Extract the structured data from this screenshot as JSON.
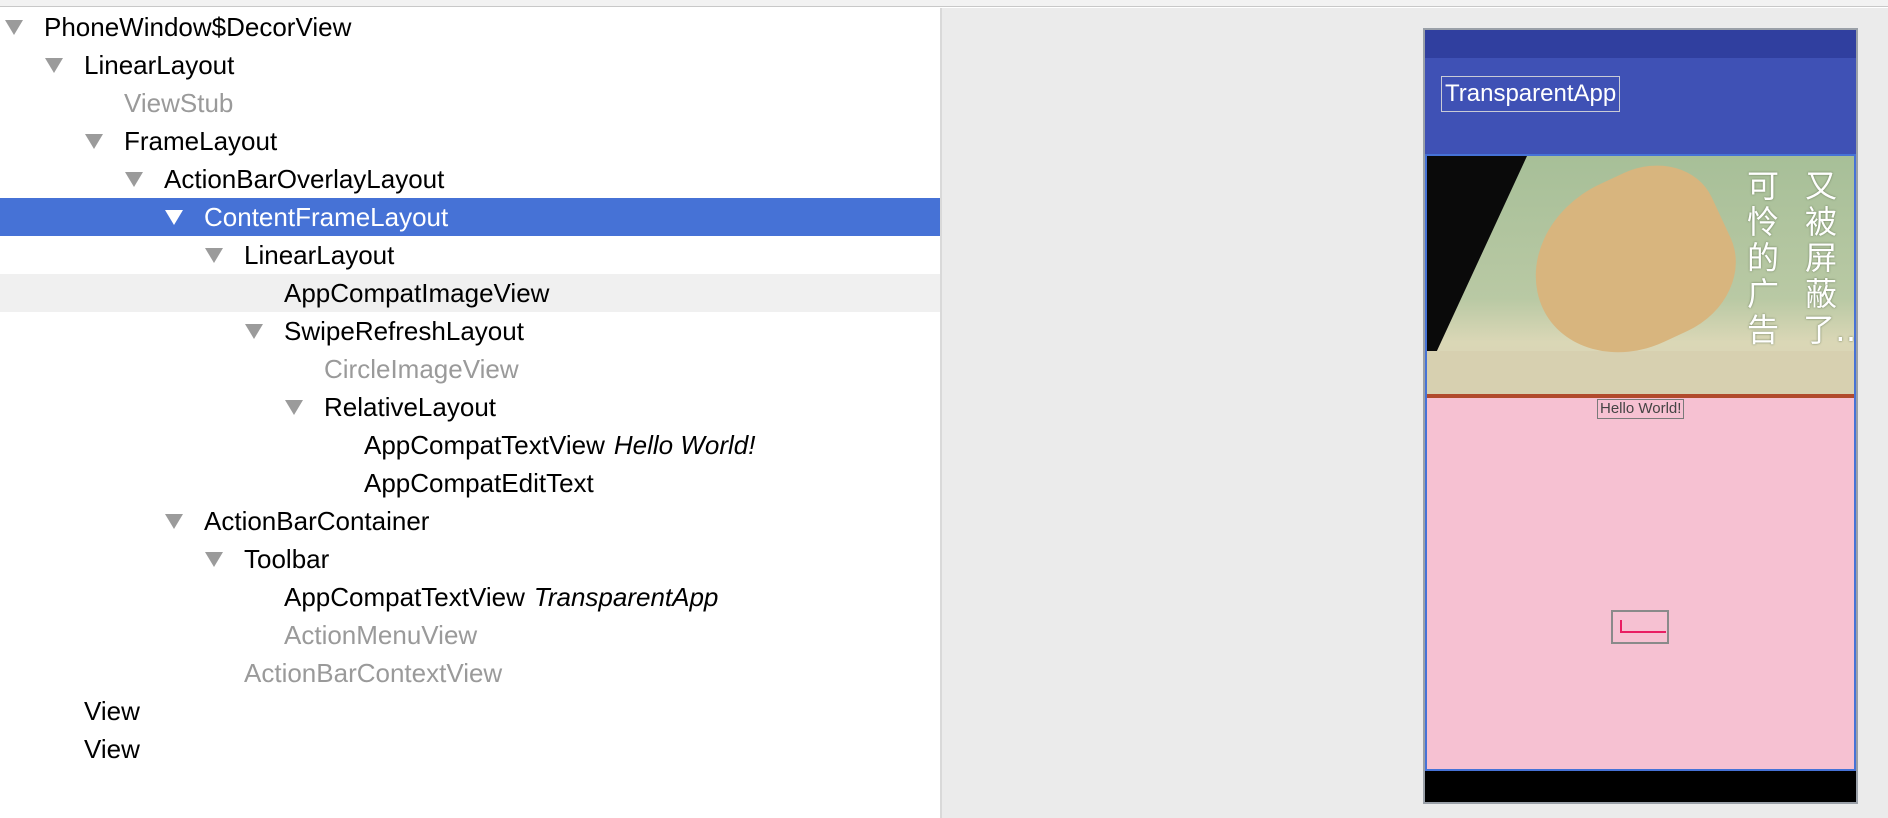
{
  "tree": {
    "rows": [
      {
        "name": "PhoneWindow$DecorView"
      },
      {
        "name": "LinearLayout"
      },
      {
        "name": "ViewStub"
      },
      {
        "name": "FrameLayout"
      },
      {
        "name": "ActionBarOverlayLayout"
      },
      {
        "name": "ContentFrameLayout"
      },
      {
        "name": "LinearLayout"
      },
      {
        "name": "AppCompatImageView"
      },
      {
        "name": "SwipeRefreshLayout"
      },
      {
        "name": "CircleImageView"
      },
      {
        "name": "RelativeLayout"
      },
      {
        "name": "AppCompatTextView",
        "text": "Hello World!"
      },
      {
        "name": "AppCompatEditText"
      },
      {
        "name": "ActionBarContainer"
      },
      {
        "name": "Toolbar"
      },
      {
        "name": "AppCompatTextView",
        "text": "TransparentApp"
      },
      {
        "name": "ActionMenuView"
      },
      {
        "name": "ActionBarContextView"
      },
      {
        "name": "View"
      },
      {
        "name": "View"
      }
    ]
  },
  "preview": {
    "app_title": "TransparentApp",
    "image_caption_right": "又被屏蔽了……",
    "image_caption_left": "可怜的广告",
    "hello_text": "Hello World!"
  },
  "colors": {
    "selection": "#4672d6",
    "status_bar": "#303f9f",
    "app_bar": "#3f51b5",
    "content_bg": "#f6c1d2",
    "accent": "#e91e63"
  }
}
